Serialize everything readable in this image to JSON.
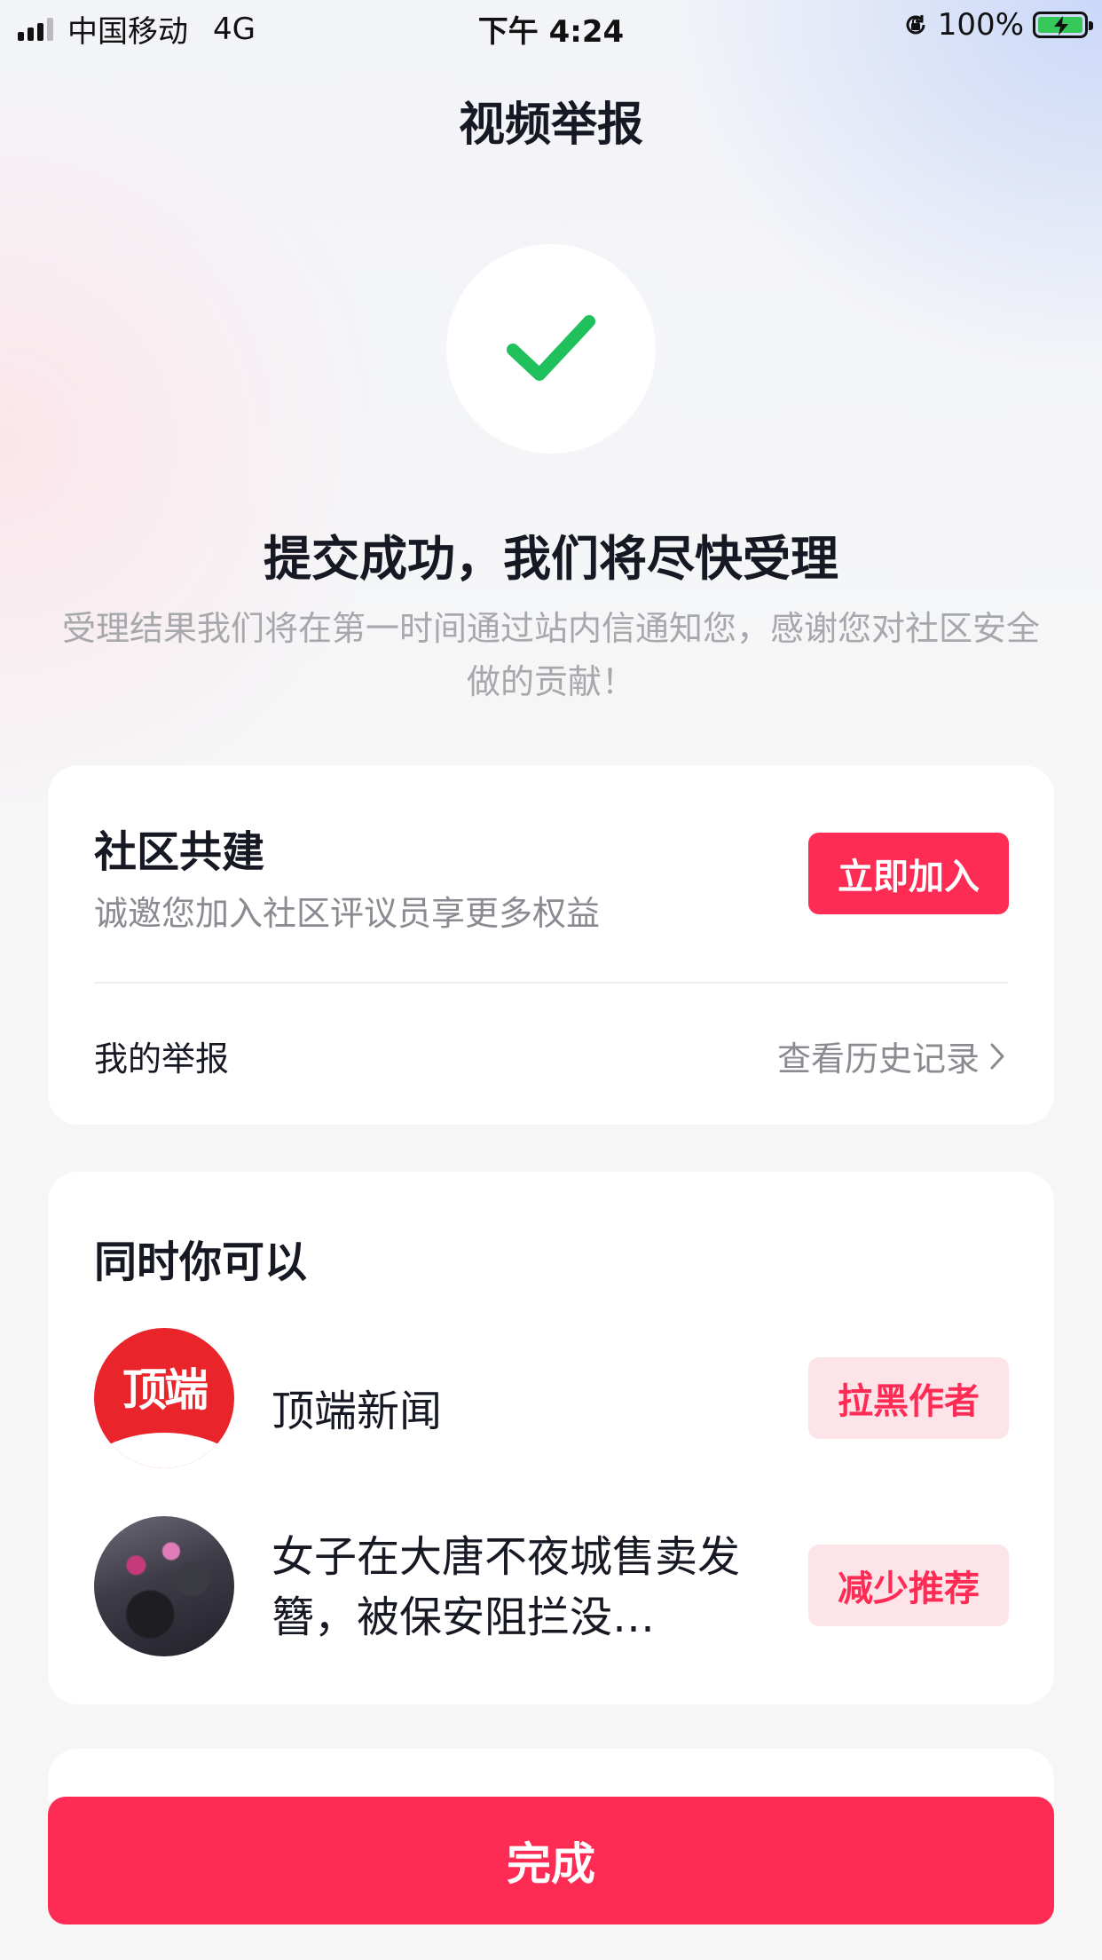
{
  "status_bar": {
    "carrier": "中国移动",
    "network": "4G",
    "time": "下午 4:24",
    "battery": "100%"
  },
  "page_title": "视频举报",
  "success": {
    "headline": "提交成功，我们将尽快受理",
    "message": "受理结果我们将在第一时间通过站内信通知您，感谢您对社区安全做的贡献！"
  },
  "community_card": {
    "title": "社区共建",
    "description": "诚邀您加入社区评议员享更多权益",
    "join_label": "立即加入",
    "my_reports_label": "我的举报",
    "history_label": "查看历史记录"
  },
  "actions_card": {
    "title": "同时你可以",
    "author": {
      "logo_text": "顶端",
      "name": "顶端新闻",
      "action_label": "拉黑作者"
    },
    "video": {
      "title": "女子在大唐不夜城售卖发簪，被保安阻拦没…",
      "action_label": "减少推荐"
    }
  },
  "done_label": "完成",
  "colors": {
    "accent": "#fe2c55",
    "accent_soft": "#fde4e9",
    "success": "#20c05c"
  },
  "icons": [
    "signal-icon",
    "rotation-lock-icon",
    "battery-charging-icon",
    "checkmark-icon",
    "chevron-right-icon"
  ]
}
